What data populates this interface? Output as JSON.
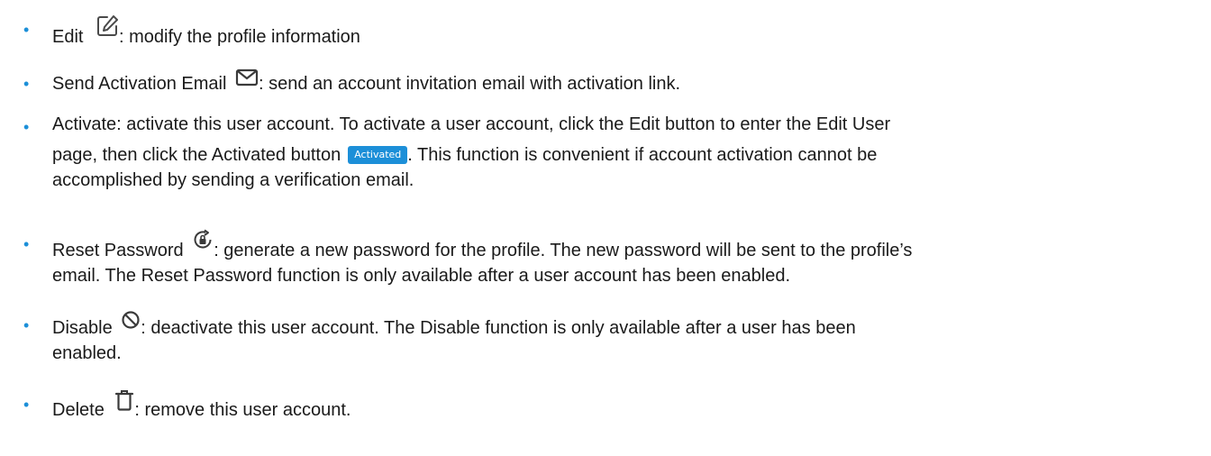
{
  "bullet_glyph": "•",
  "colors": {
    "bullet": "#1c8fd8",
    "badge_bg": "#1c8fd8",
    "text": "#1a1a1a"
  },
  "items": [
    {
      "label": "Edit",
      "icon": "edit-icon",
      "desc": ": modify the profile information"
    },
    {
      "label": "Send Activation Email",
      "icon": "mail-icon",
      "desc": ": send an account invitation email with activation link."
    },
    {
      "line1": "Activate: activate this user account. To activate a user account, click the Edit button to enter the Edit User",
      "line2_before": "page, then click the Activated button",
      "badge": "Activated",
      "line2_after": ". This function is convenient if account activation cannot be",
      "line3": "accomplished by sending a verification email."
    },
    {
      "label": "Reset Password",
      "icon": "reset-password-icon",
      "line1_after": ": generate a new password for the profile. The new password will be sent to the profile’s",
      "line2": "email. The Reset Password function is only available after a user account has been enabled."
    },
    {
      "label": "Disable",
      "icon": "disable-icon",
      "line1_after": ": deactivate this user account. The Disable function is only available after a user has been",
      "line2": "enabled."
    },
    {
      "label": "Delete",
      "icon": "trash-icon",
      "desc": ": remove this user account."
    }
  ]
}
